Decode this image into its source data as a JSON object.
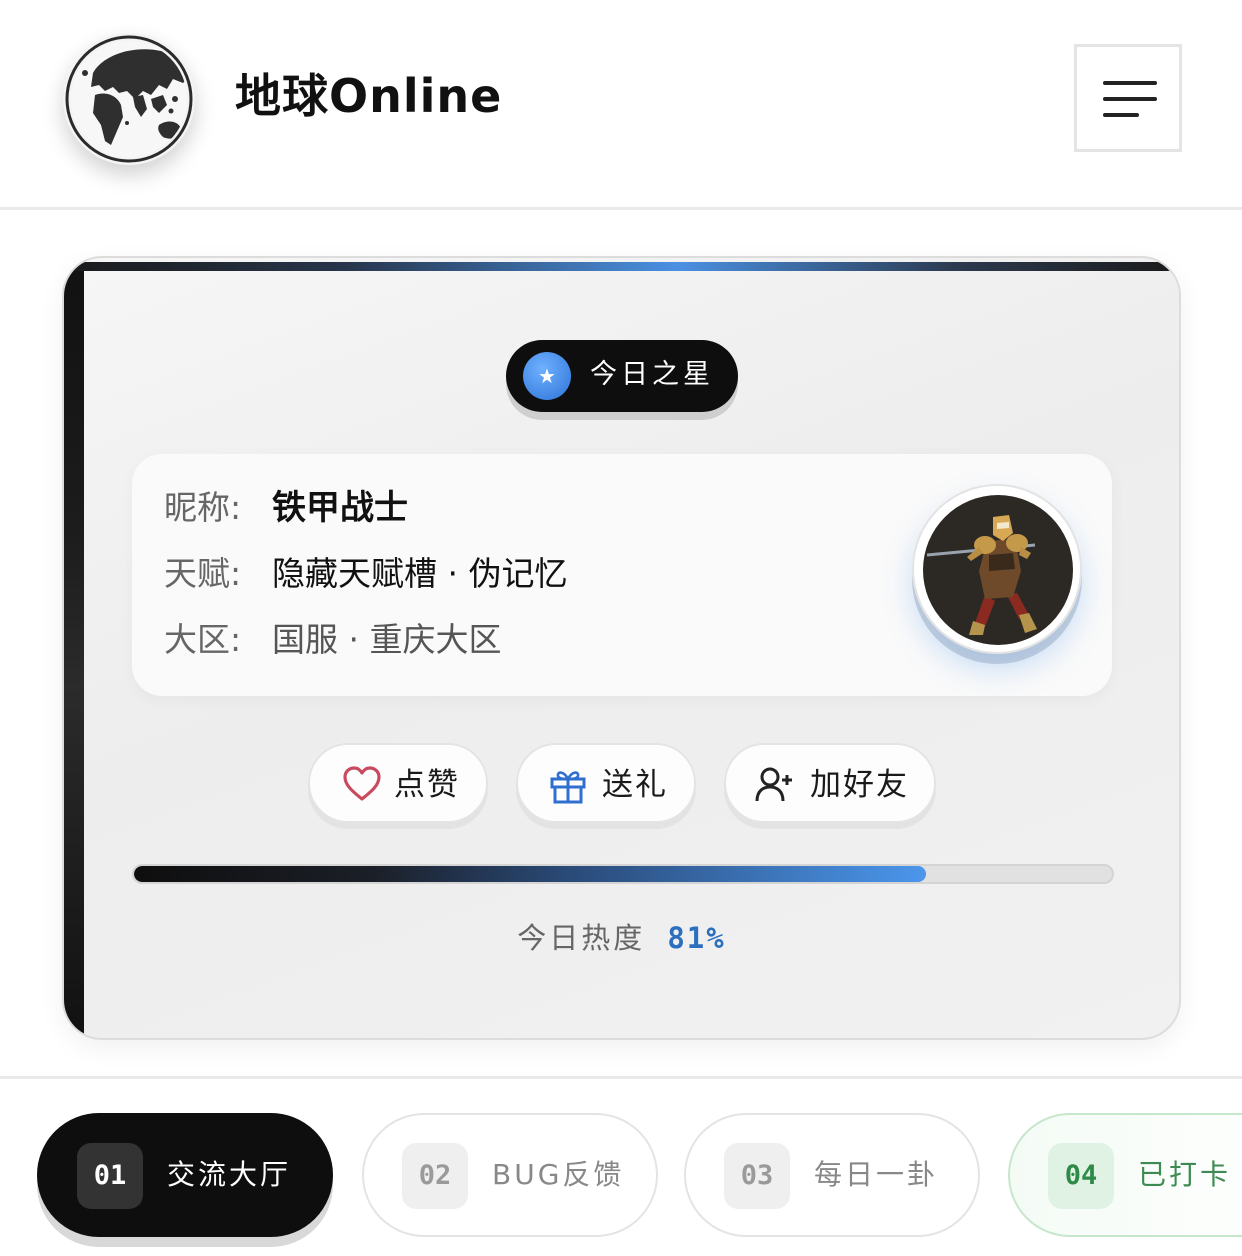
{
  "header": {
    "title": "地球Online",
    "logo_icon": "globe-icon",
    "menu_icon": "hamburger-menu-icon"
  },
  "card": {
    "badge": {
      "icon": "star-icon",
      "symbol": "★",
      "label": "今日之星"
    },
    "profile": {
      "nickname_label": "昵称:",
      "nickname": "铁甲战士",
      "talent_label": "天赋:",
      "talent": "隐藏天赋槽 · 伪记忆",
      "region_label": "大区:",
      "region": "国服 · 重庆大区",
      "avatar_icon": "warrior-avatar"
    },
    "actions": [
      {
        "icon": "heart-icon",
        "label": "点赞",
        "color": "#c94a5e"
      },
      {
        "icon": "gift-icon",
        "label": "送礼",
        "color": "#2f6fd0"
      },
      {
        "icon": "add-friend-icon",
        "label": "加好友",
        "color": "#222222"
      }
    ],
    "heat": {
      "label": "今日热度",
      "value_text": "81%",
      "value": 0.81,
      "accent": "#4a90e2"
    }
  },
  "tabs": [
    {
      "num": "01",
      "label": "交流大厅",
      "state": "active"
    },
    {
      "num": "02",
      "label": "BUG反馈",
      "state": "normal"
    },
    {
      "num": "03",
      "label": "每日一卦",
      "state": "normal"
    },
    {
      "num": "04",
      "label": "已打卡",
      "state": "done"
    }
  ]
}
